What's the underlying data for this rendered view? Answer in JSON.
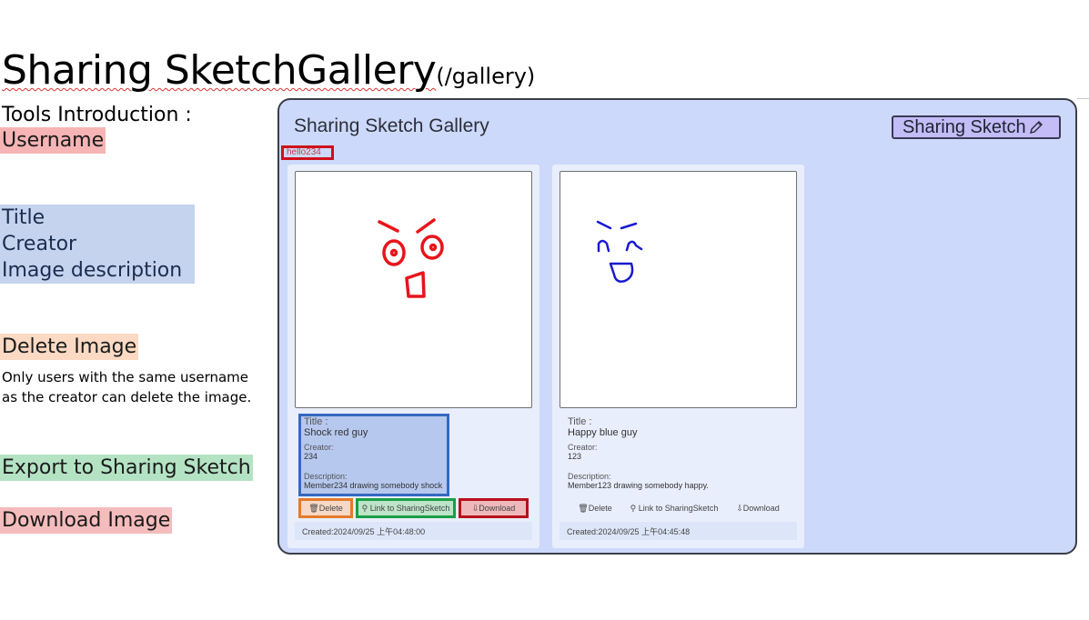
{
  "heading": {
    "title": "Sharing SketchGallery",
    "route": "(/gallery)"
  },
  "legend": {
    "intro": "Tools Introduction :",
    "username": "Username",
    "title": "Title",
    "creator": "Creator",
    "description": "Image description",
    "delete": "Delete Image",
    "delete_note_1": "Only users with the same username",
    "delete_note_2": "as the creator can delete the image.",
    "export": "Export to Sharing Sketch",
    "download": "Download Image"
  },
  "app": {
    "title": "Sharing Sketch Gallery",
    "brand_button": "Sharing Sketch",
    "username": "hello234",
    "cards": [
      {
        "title_label": "Title :",
        "title": "Shock red guy",
        "creator_label": "Creator:",
        "creator": "234",
        "description_label": "Description:",
        "description": "Member234 drawing somebody shock",
        "delete": "Delete",
        "link": "Link to SharingSketch",
        "download": "Download",
        "created": "Created:2024/09/25 上午04:48:00",
        "stroke_color": "#e8141b"
      },
      {
        "title_label": "Title :",
        "title": "Happy blue guy",
        "creator_label": "Creator:",
        "creator": "123",
        "description_label": "Description:",
        "description": "Member123 drawing somebody happy.",
        "delete": "Delete",
        "link": "Link to SharingSketch",
        "download": "Download",
        "created": "Created:2024/09/25 上午04:45:48",
        "stroke_color": "#1a1ad0"
      }
    ]
  }
}
